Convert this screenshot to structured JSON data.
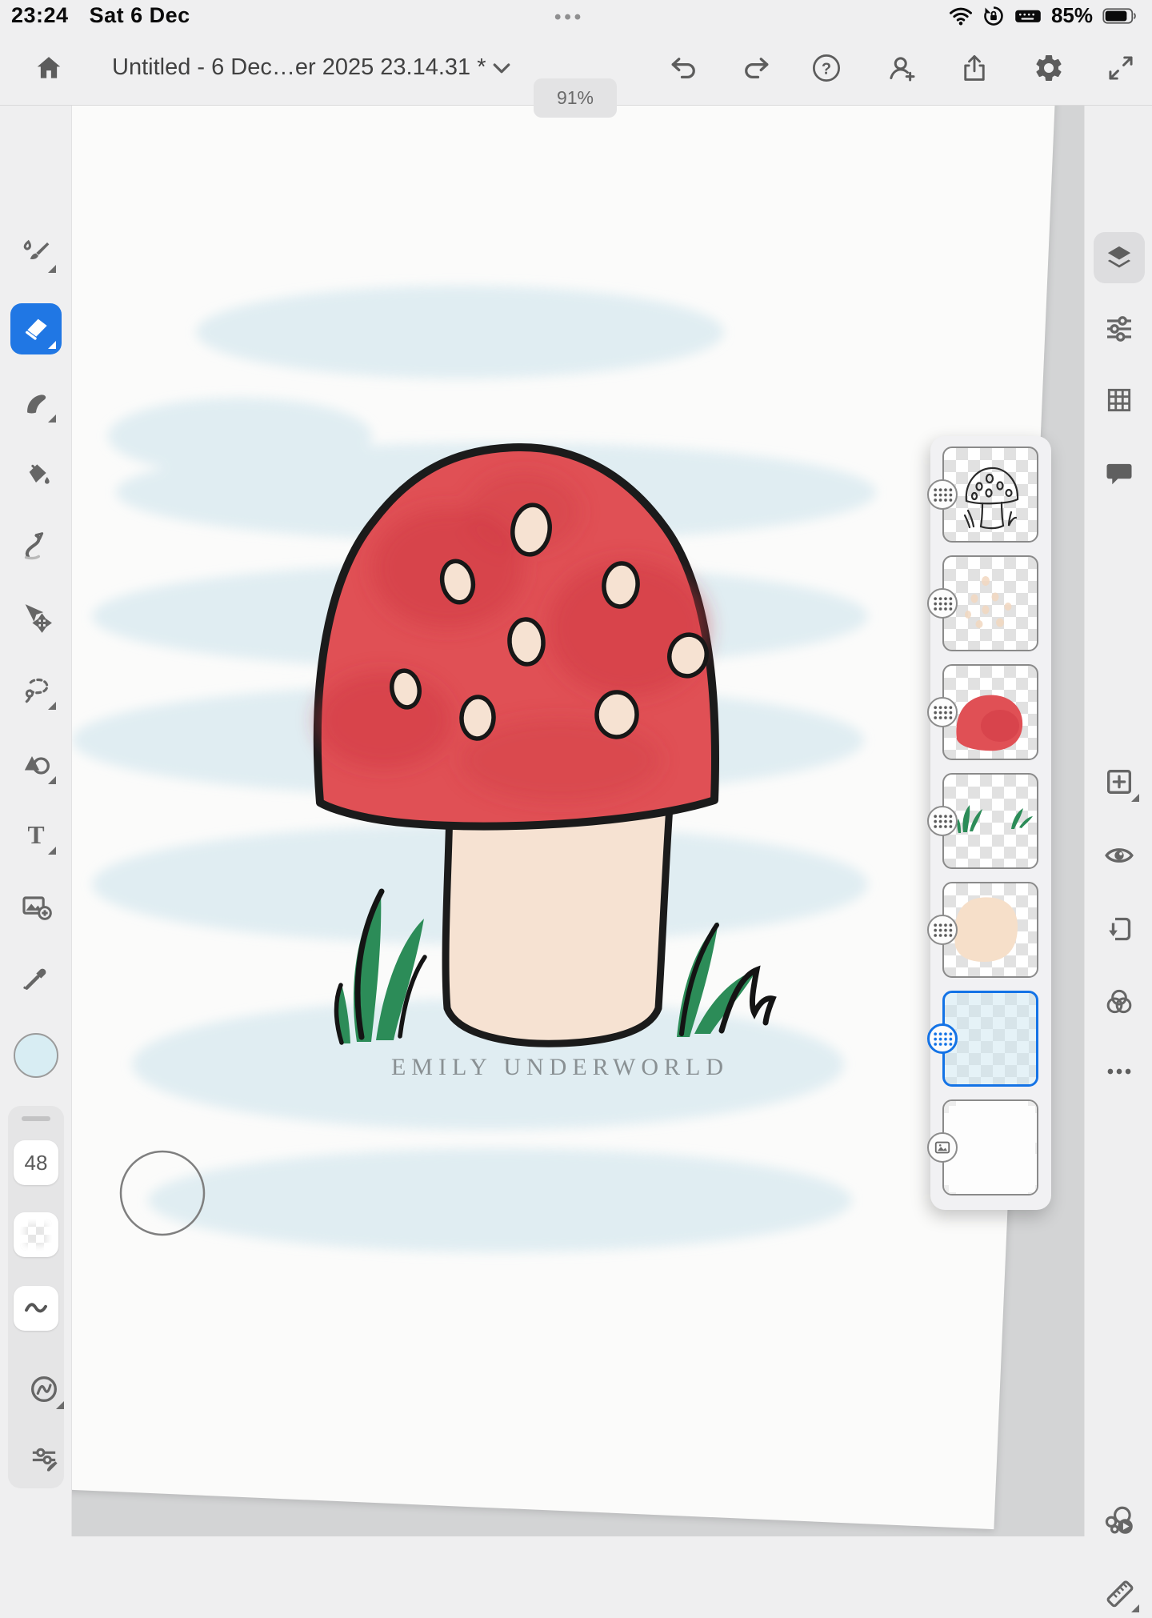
{
  "status_bar": {
    "time": "23:24",
    "date": "Sat 6 Dec",
    "multitask_dots": "•••",
    "battery_percent": "85%"
  },
  "header": {
    "title": "Untitled - 6 Dec…er 2025 23.14.31 *",
    "zoom_level": "91%"
  },
  "left_toolbar": {
    "selected_tool": "eraser",
    "tools": [
      "brush",
      "eraser",
      "smudge",
      "fill",
      "liquify",
      "move",
      "lasso",
      "shapes",
      "text",
      "add-image",
      "eyedropper"
    ]
  },
  "color_swatch": {
    "color": "#d8edf3"
  },
  "tool_options": {
    "brush_size": "48",
    "items": [
      "drag-handle",
      "size",
      "opacity-swatch",
      "smoothing",
      "stabilizer",
      "brush-settings"
    ]
  },
  "right_toolbar": {
    "selected": "layers",
    "top": [
      "layers",
      "adjustments",
      "grid",
      "comment"
    ],
    "middle": [
      "add-layer",
      "layer-visibility",
      "clip-mask",
      "blend-mode",
      "more"
    ],
    "bottom": [
      "timelapse",
      "ruler"
    ]
  },
  "layers_panel": {
    "selected_index": 5,
    "layers": [
      {
        "name": "sketch-outline"
      },
      {
        "name": "cap-spots"
      },
      {
        "name": "red-cap"
      },
      {
        "name": "grass"
      },
      {
        "name": "stem-fill"
      },
      {
        "name": "blue-wash"
      },
      {
        "name": "background"
      }
    ]
  },
  "canvas": {
    "signature": "EMILY UNDERWORLD"
  },
  "colors": {
    "accent_blue": "#1473e6",
    "eraser_selected_blue": "#2077e4",
    "cap_red": "#e05055",
    "cap_red_dark": "#cf3843",
    "stem_cream": "#f6e2d2",
    "grass_green": "#2c8c58",
    "wash_blue": "#dcebf1",
    "canvas_gray": "#d3d4d5",
    "chrome": "#efeff0"
  }
}
